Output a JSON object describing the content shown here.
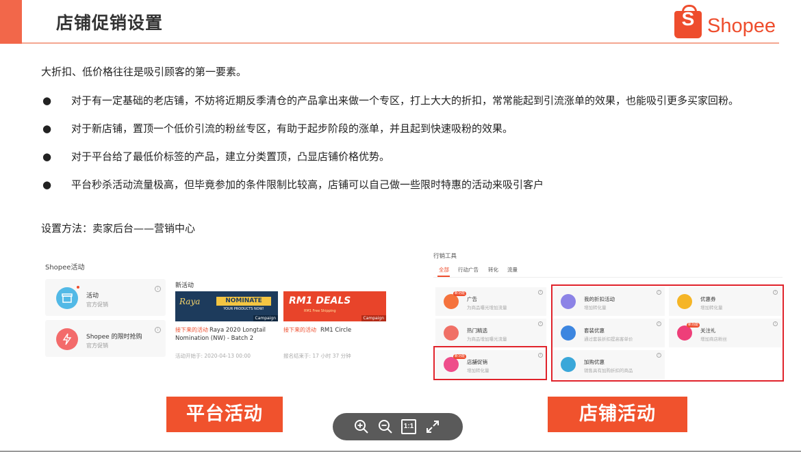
{
  "header": {
    "title": "店铺促销设置"
  },
  "logo": {
    "letter": "S",
    "text": "Shopee"
  },
  "intro": "大折扣、低价格往往是吸引顾客的第一要素。",
  "bullets": [
    "对于有一定基础的老店铺，不妨将近期反季清仓的产品拿出来做一个专区，打上大大的折扣，常常能起到引流涨单的效果，也能吸引更多买家回粉。",
    "对于新店铺，置顶一个低价引流的粉丝专区，有助于起步阶段的涨单，并且起到快速吸粉的效果。",
    "对于平台给了最低价标签的产品，建立分类置顶，凸显店铺价格优势。",
    "平台秒杀活动流量极高，但毕竟参加的条件限制比较高，店铺可以自己做一些限时特惠的活动来吸引客户"
  ],
  "bullet_symbol": "●",
  "method": "设置方法：卖家后台——营销中心",
  "left_panel": {
    "title": "Shopee活动",
    "cards": [
      {
        "name": "活动",
        "sub": "官方促销"
      },
      {
        "name": "Shopee 的限时抢购",
        "sub": "官方促销"
      }
    ],
    "new_title": "新活动",
    "campaigns": [
      {
        "banner_brand": "Raya",
        "banner_headline": "NOMINATE",
        "banner_sub": "YOUR PRODUCTS NOW!",
        "banner_tag": "Campaign",
        "tag": "接下来的活动",
        "name": "Raya 2020 Longtail Nomination (NW) - Batch 2",
        "time": "活动开始于: 2020-04-13 00:00"
      },
      {
        "banner_headline": "RM1 DEALS",
        "banner_sub": "RM1 Free Shipping",
        "banner_tag": "Campaign",
        "tag": "接下来的活动",
        "name": "RM1 Circle",
        "time": "报名结束于: 17 小时 37 分钟"
      }
    ],
    "info_symbol": "i"
  },
  "right_panel": {
    "title": "行销工具",
    "tabs": [
      "全部",
      "行动广告",
      "转化",
      "流量"
    ],
    "tools": [
      {
        "name": "广告",
        "sub": "为商品曝光增加流量",
        "badge": "新功能",
        "color": "#f5733d"
      },
      {
        "name": "我的折扣活动",
        "sub": "增加转化量",
        "color": "#8c83e6"
      },
      {
        "name": "优惠券",
        "sub": "增加转化量",
        "color": "#f5b526"
      },
      {
        "name": "热门精选",
        "sub": "为商品增加曝光流量",
        "color": "#f07066"
      },
      {
        "name": "套装优惠",
        "sub": "通过套装折扣提高客单价",
        "color": "#3d86e0"
      },
      {
        "name": "关注礼",
        "sub": "增加商店粉丝",
        "badge": "新功能",
        "color": "#ee3f79"
      },
      {
        "name": "店舖促销",
        "sub": "增加转化量",
        "badge": "新功能",
        "color": "#ee4d8a"
      },
      {
        "name": "加购优惠",
        "sub": "销售具有加购折扣的商品",
        "color": "#3aa7d9"
      }
    ],
    "info_symbol": "i"
  },
  "labels": {
    "platform": "平台活动",
    "store": "店铺活动"
  },
  "zoom": {
    "fit_label": "1:1"
  },
  "colors": {
    "accent": "#ee4d2d",
    "highlight": "#e0222a",
    "label_bg": "#f0522d"
  }
}
